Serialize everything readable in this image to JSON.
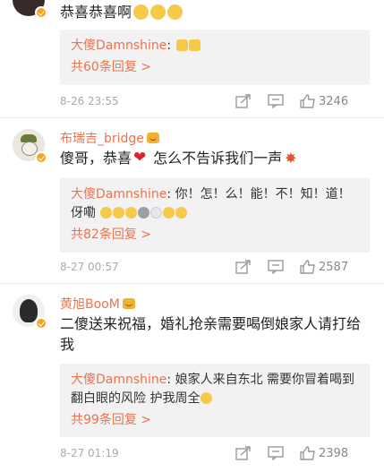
{
  "comments": [
    {
      "text": "恭喜恭喜啊",
      "reply": {
        "author": "大傻Damnshine",
        "separator": ":",
        "text": ""
      },
      "more": "共60条回复 >",
      "time": "8-26 23:55",
      "likes": "3246"
    },
    {
      "name": "布瑞吉_bridge",
      "text_before": "傻哥，恭喜",
      "text_after": " 怎么不告诉我们一声",
      "reply": {
        "author": "大傻Damnshine",
        "separator": ":",
        "text": " 你！怎！么！能！不！知！道！ 伢嘞"
      },
      "more": "共82条回复 >",
      "time": "8-27 00:57",
      "likes": "2587"
    },
    {
      "name": "黄旭BooM",
      "text": "二傻送来祝福，婚礼抢亲需要喝倒娘家人请打给我",
      "reply": {
        "author": "大傻Damnshine",
        "separator": ":",
        "text": " 娘家人来自东北 需要你冒着喝到翻白眼的风险 护我周全"
      },
      "more": "共99条回复 >",
      "time": "8-27 01:19",
      "likes": "2398"
    }
  ],
  "icons": [
    "share-icon",
    "comment-icon",
    "like-icon"
  ],
  "colors": {
    "accent": "#eb7350",
    "reply_bg": "#f2f2f2",
    "meta": "#aaaaaa"
  }
}
